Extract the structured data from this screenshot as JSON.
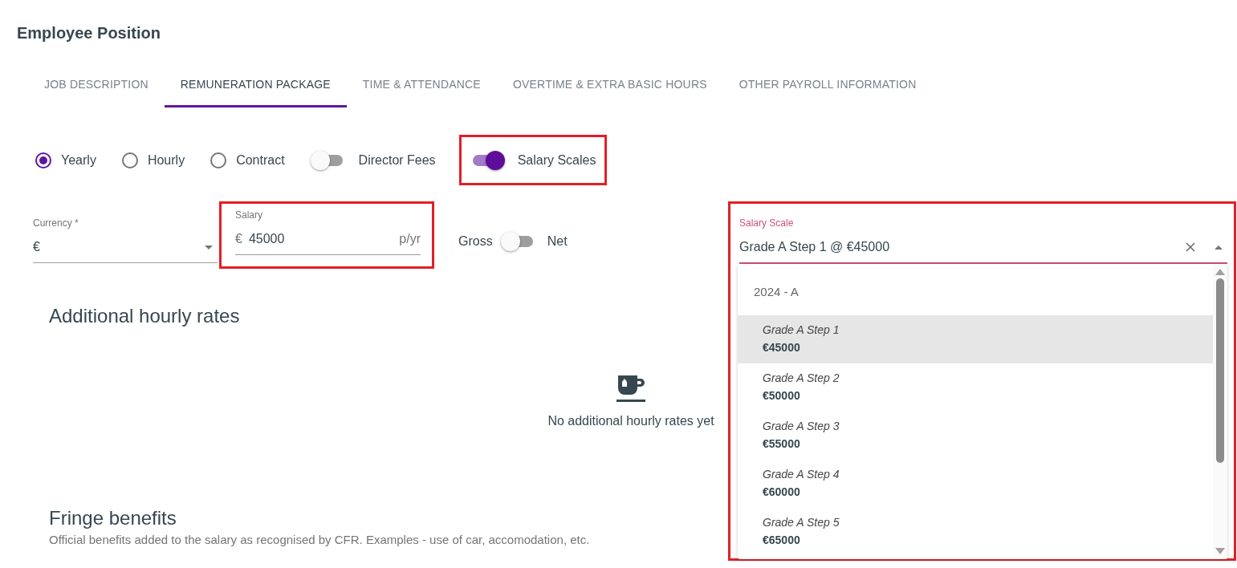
{
  "page": {
    "title": "Employee Position"
  },
  "tabs": [
    {
      "label": "JOB DESCRIPTION",
      "selected": false
    },
    {
      "label": "REMUNERATION PACKAGE",
      "selected": true
    },
    {
      "label": "TIME & ATTENDANCE",
      "selected": false
    },
    {
      "label": "OVERTIME & EXTRA BASIC HOURS",
      "selected": false
    },
    {
      "label": "OTHER PAYROLL INFORMATION",
      "selected": false
    }
  ],
  "pay_options": [
    {
      "kind": "radio",
      "label": "Yearly",
      "selected": true,
      "highlighted": false
    },
    {
      "kind": "radio",
      "label": "Hourly",
      "selected": false,
      "highlighted": false
    },
    {
      "kind": "radio",
      "label": "Contract",
      "selected": false,
      "highlighted": false
    },
    {
      "kind": "switch",
      "label": "Director Fees",
      "on": false,
      "highlighted": false
    },
    {
      "kind": "switch",
      "label": "Salary Scales",
      "on": true,
      "highlighted": true
    }
  ],
  "currency": {
    "label": "Currency *",
    "value": "€"
  },
  "salary": {
    "label": "Salary",
    "prefix": "€",
    "value": "45000",
    "suffix": "p/yr",
    "highlighted": true
  },
  "gross_net": {
    "left_label": "Gross",
    "right_label": "Net",
    "on": false
  },
  "salary_scale": {
    "label": "Salary Scale",
    "value": "Grade A Step 1 @ €45000",
    "highlighted": true,
    "expanded": true,
    "group": "2024 - A",
    "options": [
      {
        "name": "Grade A Step 1",
        "amount": "€45000",
        "selected": true
      },
      {
        "name": "Grade A Step 2",
        "amount": "€50000",
        "selected": false
      },
      {
        "name": "Grade A Step 3",
        "amount": "€55000",
        "selected": false
      },
      {
        "name": "Grade A Step 4",
        "amount": "€60000",
        "selected": false
      },
      {
        "name": "Grade A Step 5",
        "amount": "€65000",
        "selected": false
      }
    ]
  },
  "additional_hourly_rates": {
    "heading": "Additional hourly rates",
    "empty_text": "No additional hourly rates yet"
  },
  "fringe_benefits": {
    "heading": "Fringe benefits",
    "description": "Official benefits added to the salary as recognised by CFR. Examples - use of car, accomodation, etc."
  }
}
